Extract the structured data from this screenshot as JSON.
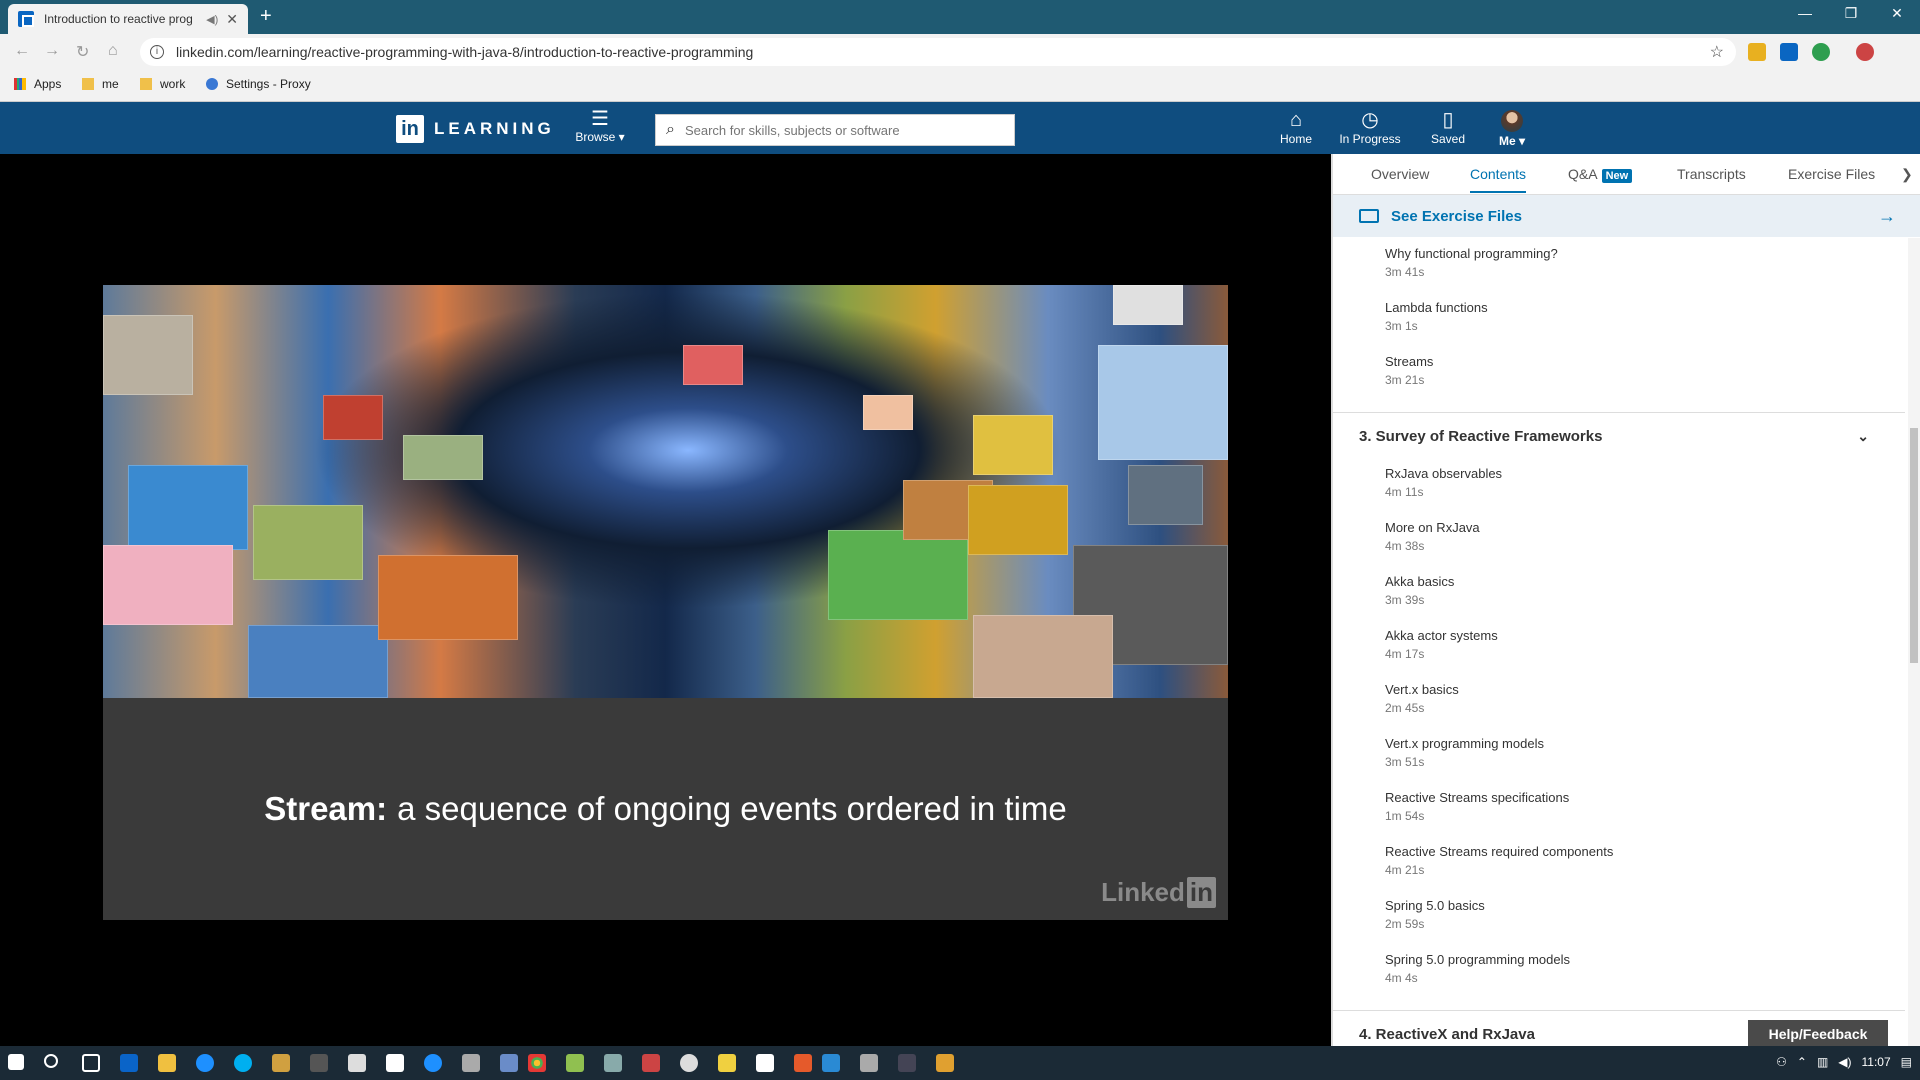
{
  "browser": {
    "tab_title": "Introduction to reactive prog",
    "url": "linkedin.com/learning/reactive-programming-with-java-8/introduction-to-reactive-programming",
    "bookmarks": [
      {
        "label": "Apps",
        "icon": "apps-grid-icon"
      },
      {
        "label": "me",
        "icon": "folder-icon"
      },
      {
        "label": "work",
        "icon": "folder-icon"
      },
      {
        "label": "Settings - Proxy",
        "icon": "gear-icon"
      }
    ]
  },
  "header": {
    "logo_text": "LEARNING",
    "browse_label": "Browse",
    "search_placeholder": "Search for skills, subjects or software",
    "nav": [
      {
        "label": "Home",
        "icon": "home-icon"
      },
      {
        "label": "In Progress",
        "icon": "clock-icon"
      },
      {
        "label": "Saved",
        "icon": "bookmark-icon"
      },
      {
        "label": "Me",
        "icon": "avatar"
      }
    ]
  },
  "video": {
    "caption_bold": "Stream:",
    "caption_rest": "a sequence of ongoing events ordered in time",
    "watermark": "Linked",
    "watermark_box": "in"
  },
  "panel": {
    "tabs": [
      {
        "label": "Overview",
        "active": false
      },
      {
        "label": "Contents",
        "active": true
      },
      {
        "label": "Q&A",
        "badge": "New",
        "active": false
      },
      {
        "label": "Transcripts",
        "active": false
      },
      {
        "label": "Exercise Files",
        "active": false
      }
    ],
    "see_exercise_files": "See Exercise Files",
    "top_items": [
      {
        "title": "Why functional programming?",
        "duration": "3m 41s"
      },
      {
        "title": "Lambda functions",
        "duration": "3m 1s"
      },
      {
        "title": "Streams",
        "duration": "3m 21s"
      }
    ],
    "section3": {
      "title": "3. Survey of Reactive Frameworks",
      "items": [
        {
          "title": "RxJava observables",
          "duration": "4m 11s"
        },
        {
          "title": "More on RxJava",
          "duration": "4m 38s"
        },
        {
          "title": "Akka basics",
          "duration": "3m 39s"
        },
        {
          "title": "Akka actor systems",
          "duration": "4m 17s"
        },
        {
          "title": "Vert.x basics",
          "duration": "2m 45s"
        },
        {
          "title": "Vert.x programming models",
          "duration": "3m 51s"
        },
        {
          "title": "Reactive Streams specifications",
          "duration": "1m 54s"
        },
        {
          "title": "Reactive Streams required components",
          "duration": "4m 21s"
        },
        {
          "title": "Spring 5.0 basics",
          "duration": "2m 59s"
        },
        {
          "title": "Spring 5.0 programming models",
          "duration": "4m 4s"
        }
      ]
    },
    "section4_title": "4. ReactiveX and RxJava",
    "help_label": "Help/Feedback"
  },
  "taskbar": {
    "time": "11:07"
  }
}
